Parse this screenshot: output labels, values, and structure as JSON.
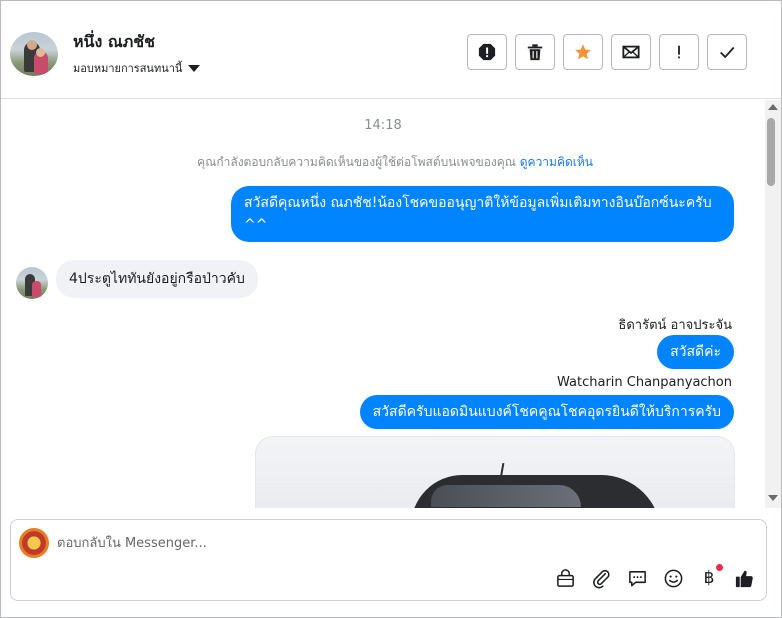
{
  "header": {
    "contact_name": "หนึ่ง ณภชัช",
    "assign_label": "มอบหมายการสนทนานี้",
    "actions": [
      {
        "name": "spam-button",
        "icon": "exclamation-octagon-icon"
      },
      {
        "name": "delete-button",
        "icon": "trash-icon"
      },
      {
        "name": "star-button",
        "icon": "star-icon"
      },
      {
        "name": "mark-unread-button",
        "icon": "envelope-icon"
      },
      {
        "name": "follow-up-button",
        "icon": "exclamation-icon"
      },
      {
        "name": "mark-done-button",
        "icon": "check-icon"
      }
    ],
    "star_color": "#f7923a"
  },
  "conversation": {
    "timestamp": "14:18",
    "context_note": "คุณกำลังตอบกลับความคิดเห็นของผู้ใช้ต่อโพสต์บนเพจของคุณ",
    "context_link": "ดูความคิดเห็น",
    "messages": [
      {
        "direction": "out",
        "text": "สวัสดีคุณหนึ่ง ณภชัช!น้องโชคขออนุญาติให้ข้อมูลเพิ่มเติมทางอินบ๊อกซ์นะครับ ^^"
      },
      {
        "direction": "in",
        "text": "4ประตูไททันยังอยู่กรือป่าวคับ"
      },
      {
        "direction": "out",
        "sender": "ธิดารัตน์ อาจประจัน",
        "text": "สวัสดีค่ะ"
      },
      {
        "direction": "out",
        "sender": "Watcharin Chanpanyachon",
        "text": "สวัสดีครับแอดมินแบงค์โชคคูณโชคอุดรยินดีให้บริการครับ"
      }
    ],
    "outgoing_color": "#0084ff",
    "incoming_color": "#f0f2f5"
  },
  "composer": {
    "placeholder": "ตอบกลับใน Messenger...",
    "tools": [
      "shopping-bag-icon",
      "paperclip-icon",
      "chat-bubble-icon",
      "smiley-icon",
      "baht-icon",
      "thumbs-up-icon"
    ],
    "baht_symbol": "฿"
  }
}
